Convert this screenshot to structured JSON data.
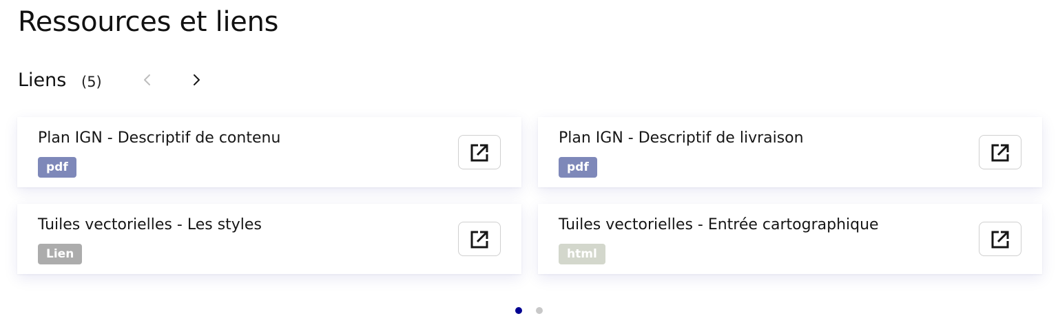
{
  "page": {
    "title": "Ressources et liens"
  },
  "section": {
    "title": "Liens",
    "count": "(5)",
    "prev_icon": "chevron-left-icon",
    "next_icon": "chevron-right-icon"
  },
  "cards": [
    {
      "title": "Plan IGN - Descriptif de contenu",
      "badge": "pdf",
      "badge_color": "#7e88b9",
      "action_icon": "external-link-icon"
    },
    {
      "title": "Plan IGN - Descriptif de livraison",
      "badge": "pdf",
      "badge_color": "#7e88b9",
      "action_icon": "external-link-icon"
    },
    {
      "title": "Tuiles vectorielles - Les styles",
      "badge": "Lien",
      "badge_color": "#acacac",
      "action_icon": "external-link-icon"
    },
    {
      "title": "Tuiles vectorielles - Entrée cartographique",
      "badge": "html",
      "badge_color": "#d3d7cc",
      "action_icon": "external-link-icon"
    }
  ],
  "pagination": {
    "pages": 2,
    "current": 1,
    "active_color": "#000091",
    "inactive_color": "#c8c8c8"
  },
  "colors": {
    "nav_prev": "#bdbdbd",
    "nav_next": "#161616"
  }
}
